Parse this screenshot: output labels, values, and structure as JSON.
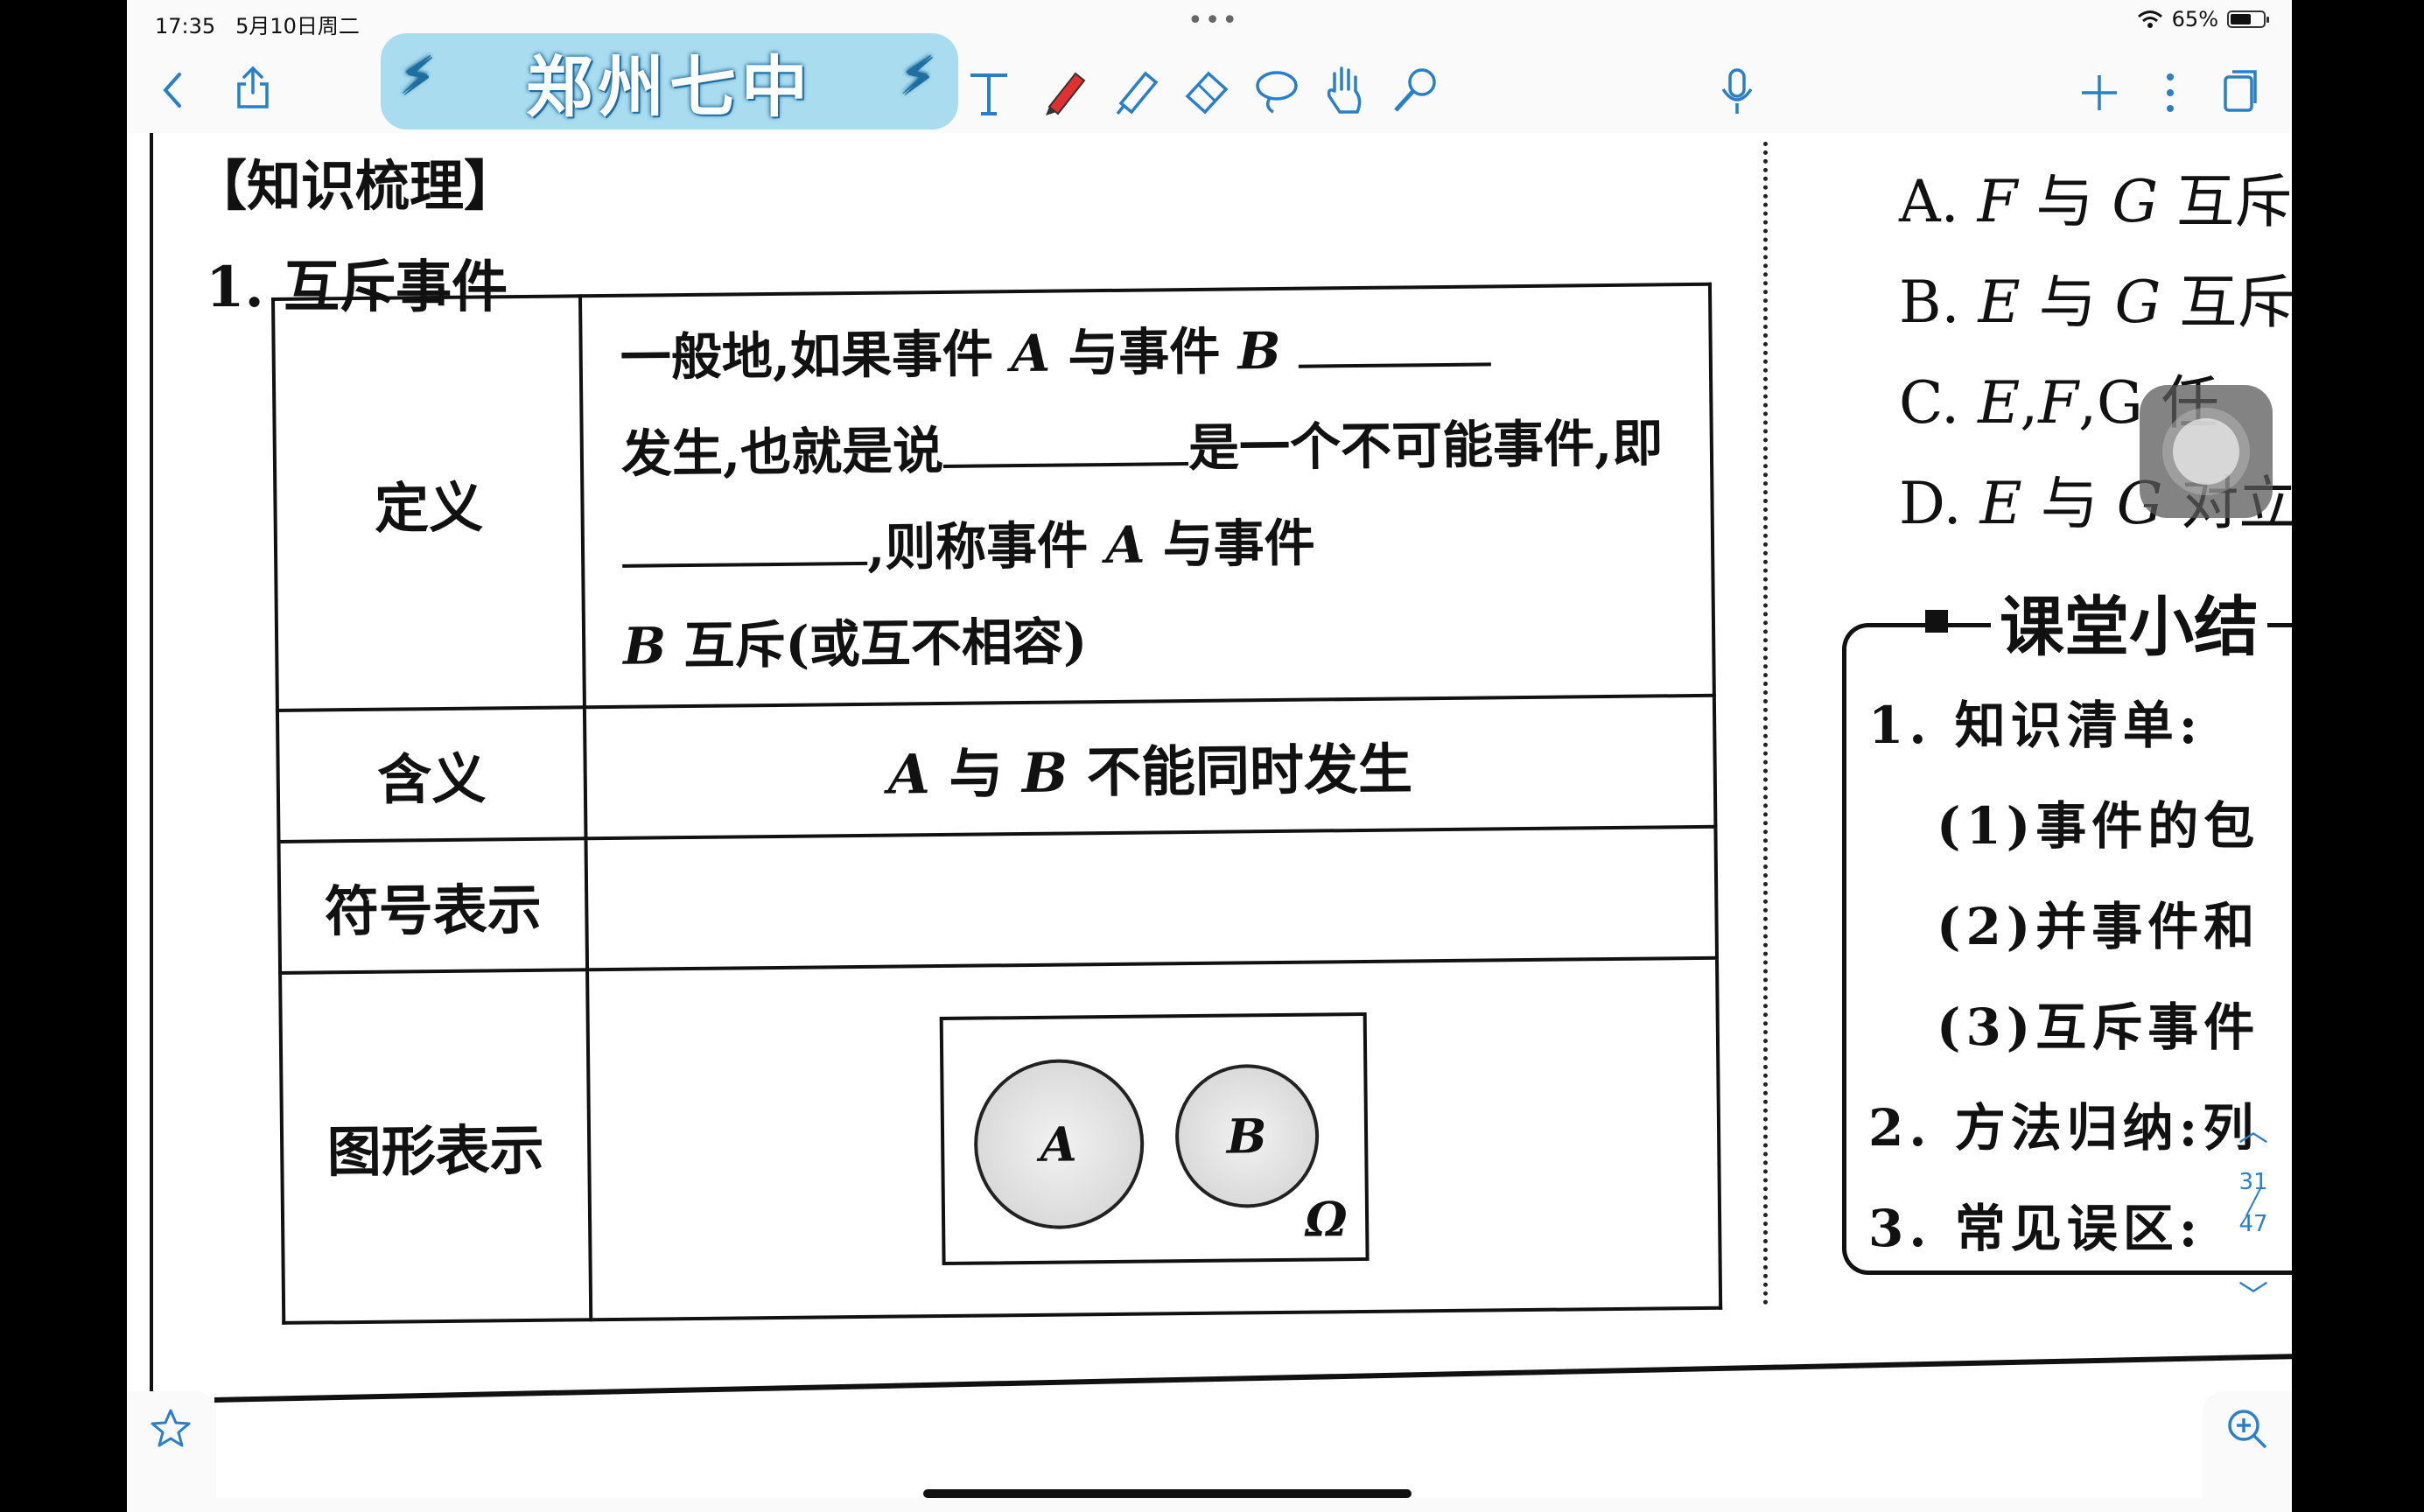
{
  "status_bar": {
    "time": "17:35",
    "date": "5月10日周二",
    "battery": "65%",
    "battery_level": 0.65
  },
  "toolbar": {
    "logo_text": "郑州七中",
    "icons": [
      "back-icon",
      "share-icon",
      "text-tool-icon",
      "pen-icon",
      "highlighter-icon",
      "eraser-icon",
      "lasso-icon",
      "hand-icon",
      "laser-pointer-icon",
      "microphone-icon",
      "add-icon",
      "more-icon",
      "pages-icon"
    ]
  },
  "document": {
    "heading": "【知识梳理】",
    "section": "1. 互斥事件",
    "table": {
      "definition_label": "定义",
      "definition_part1": "一般地,如果事件 ",
      "var_a": "A",
      "definition_part2": " 与事件 ",
      "var_b": "B",
      "definition_part3": "发生,也就是说",
      "definition_part4": "是一个不可能事件,即",
      "definition_part5": ",则称事件 ",
      "definition_part6": " 与事件",
      "definition_part7": " 互斥(或互不相容)",
      "meaning_label": "含义",
      "meaning_part1": " 与 ",
      "meaning_part2": " 不能同时发生",
      "symbol_label": "符号表示",
      "symbol_value": "",
      "figure_label": "图形表示",
      "venn_a": "A",
      "venn_b": "B",
      "venn_omega": "Ω"
    },
    "right_column": {
      "options": [
        {
          "prefix": "A. ",
          "v1": "F",
          "mid": " 与 ",
          "v2": "G",
          "suffix": " 互斥"
        },
        {
          "prefix": "B. ",
          "v1": "E",
          "mid": " 与 ",
          "v2": "G",
          "suffix": " 互斥"
        },
        {
          "prefix": "C. ",
          "v1": "E",
          "mid": ",",
          "v2": "F",
          "suffix": ",G 任"
        },
        {
          "prefix": "D. ",
          "v1": "E",
          "mid": " 与 ",
          "v2": "G",
          "suffix": " 对立"
        }
      ],
      "summary_title": "课堂小结",
      "summary_lines": [
        "1. 知识清单:",
        "(1)事件的包",
        "(2)并事件和",
        "(3)互斥事件",
        "2. 方法归纳:列",
        "3. 常见误区:"
      ]
    }
  },
  "pager": {
    "current": "31",
    "total": "47"
  }
}
